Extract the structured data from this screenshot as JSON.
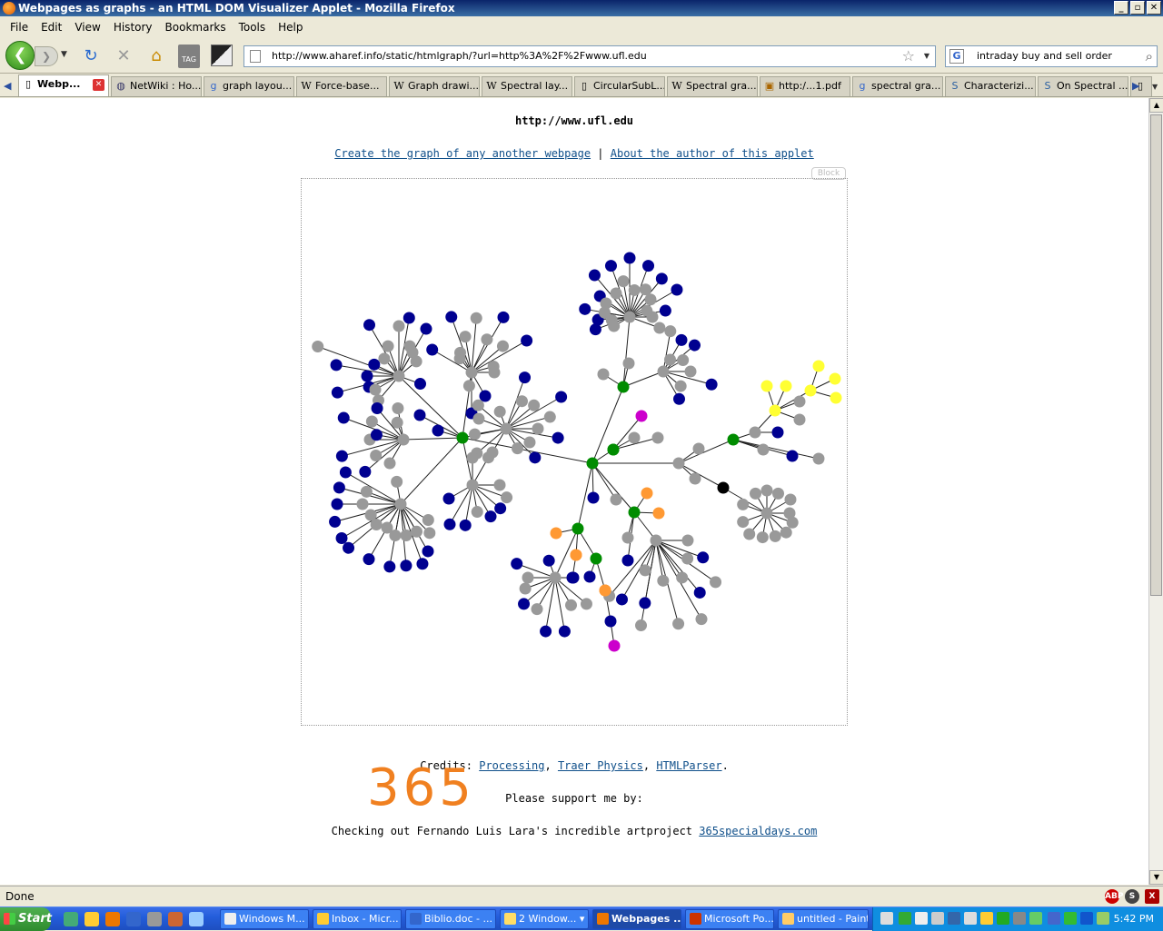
{
  "window": {
    "title": "Webpages as graphs - an HTML DOM Visualizer Applet - Mozilla Firefox",
    "controls": [
      "_",
      "▫",
      "✕"
    ]
  },
  "menu": [
    "File",
    "Edit",
    "View",
    "History",
    "Bookmarks",
    "Tools",
    "Help"
  ],
  "navbar": {
    "url": "http://www.aharef.info/static/htmlgraph/?url=http%3A%2F%2Fwww.ufl.edu",
    "search_value": "intraday buy and sell order"
  },
  "tabs": [
    {
      "label": "Webp...",
      "icon": "page"
    },
    {
      "label": "NetWiki : Ho...",
      "icon": "globe"
    },
    {
      "label": "graph layou...",
      "icon": "google"
    },
    {
      "label": "Force-base...",
      "icon": "W"
    },
    {
      "label": "Graph drawi...",
      "icon": "W"
    },
    {
      "label": "Spectral lay...",
      "icon": "W"
    },
    {
      "label": "CircularSubL...",
      "icon": "page"
    },
    {
      "label": "Spectral gra...",
      "icon": "W"
    },
    {
      "label": "http:/...1.pdf",
      "icon": "pdf"
    },
    {
      "label": "spectral gra...",
      "icon": "google"
    },
    {
      "label": "Characterizi...",
      "icon": "S"
    },
    {
      "label": "On Spectral ...",
      "icon": "S"
    },
    {
      "label": "",
      "icon": "page"
    }
  ],
  "page": {
    "site_url": "http://www.ufl.edu",
    "link_create": "Create the graph of any another webpage",
    "separator": "|",
    "link_about": "About the author of this applet",
    "block_label": "Block",
    "credits_prefix": "Credits:",
    "credit_links": [
      "Processing",
      "Traer Physics",
      "HTMLParser"
    ],
    "support_text": "Please support me by:",
    "artproject_text": "Checking out Fernando Luis Lara's incredible artproject",
    "artproject_link": "365specialdays.com",
    "big_number": "365"
  },
  "graph_colors": {
    "gray": "#999999",
    "navy": "#000090",
    "green": "#008c00",
    "yellow": "#ffff33",
    "orange": "#ff9933",
    "magenta": "#cc00cc",
    "black": "#000000"
  },
  "status": {
    "text": "Done"
  },
  "taskbar": {
    "start_label": "Start",
    "items": [
      "Windows M...",
      "Inbox - Micr...",
      "Biblio.doc - ...",
      "2 Window... ▾",
      "Webpages ...",
      "Microsoft Po...",
      "untitled - Paint"
    ],
    "clock": "5:42 PM"
  }
}
